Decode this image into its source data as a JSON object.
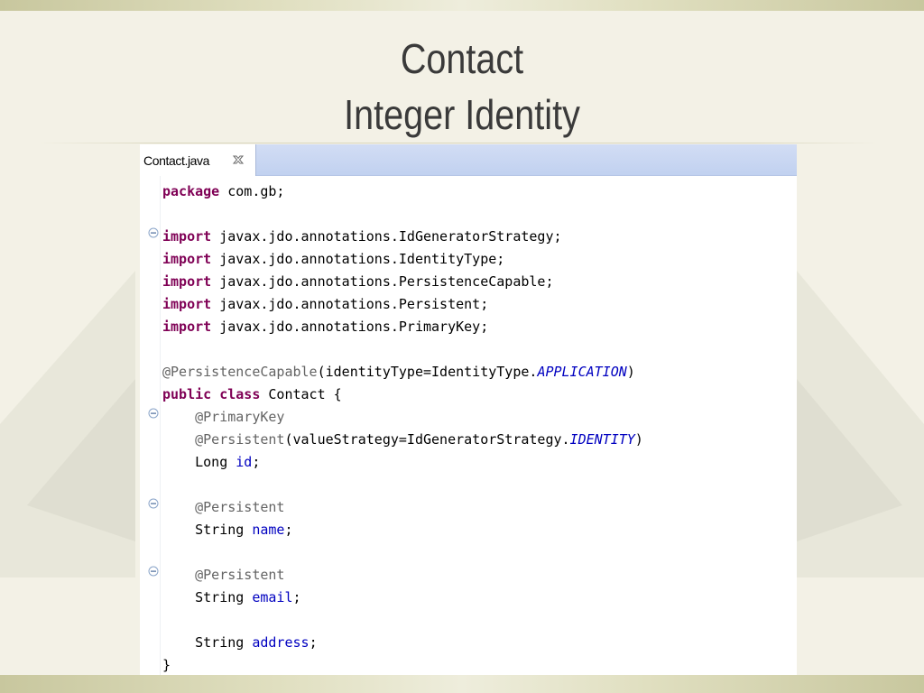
{
  "slide": {
    "title_line1": "Contact",
    "title_line2": "Integer Identity"
  },
  "editor": {
    "tab_label": "Contact.java",
    "tab_close_icon": "close-icon",
    "fold_icon": "collapse-minus-icon",
    "colors": {
      "keyword": "#7f0055",
      "annotation": "#646464",
      "field": "#0000c0",
      "tab_bar": "#c6d4f2"
    },
    "code": {
      "l1": {
        "kw": "package",
        "rest": " com.gb;"
      },
      "l3": {
        "kw": "import",
        "rest": " javax.jdo.annotations.IdGeneratorStrategy;"
      },
      "l4": {
        "kw": "import",
        "rest": " javax.jdo.annotations.IdentityType;"
      },
      "l5": {
        "kw": "import",
        "rest": " javax.jdo.annotations.PersistenceCapable;"
      },
      "l6": {
        "kw": "import",
        "rest": " javax.jdo.annotations.Persistent;"
      },
      "l7": {
        "kw": "import",
        "rest": " javax.jdo.annotations.PrimaryKey;"
      },
      "l9": {
        "ann": "@PersistenceCapable",
        "a": "(identityType=IdentityType.",
        "cst": "APPLICATION",
        "b": ")"
      },
      "l10": {
        "kw1": "public",
        "kw2": "class",
        "rest": " Contact {"
      },
      "l11": {
        "ann": "@PrimaryKey"
      },
      "l12": {
        "ann": "@Persistent",
        "a": "(valueStrategy=IdGeneratorStrategy.",
        "cst": "IDENTITY",
        "b": ")"
      },
      "l13": {
        "type": "Long ",
        "fld": "id",
        "end": ";"
      },
      "l15": {
        "ann": "@Persistent"
      },
      "l16": {
        "type": "String ",
        "fld": "name",
        "end": ";"
      },
      "l18": {
        "ann": "@Persistent"
      },
      "l19": {
        "type": "String ",
        "fld": "email",
        "end": ";"
      },
      "l21": {
        "type": "String ",
        "fld": "address",
        "end": ";"
      },
      "l22": {
        "rest": "}"
      }
    }
  }
}
